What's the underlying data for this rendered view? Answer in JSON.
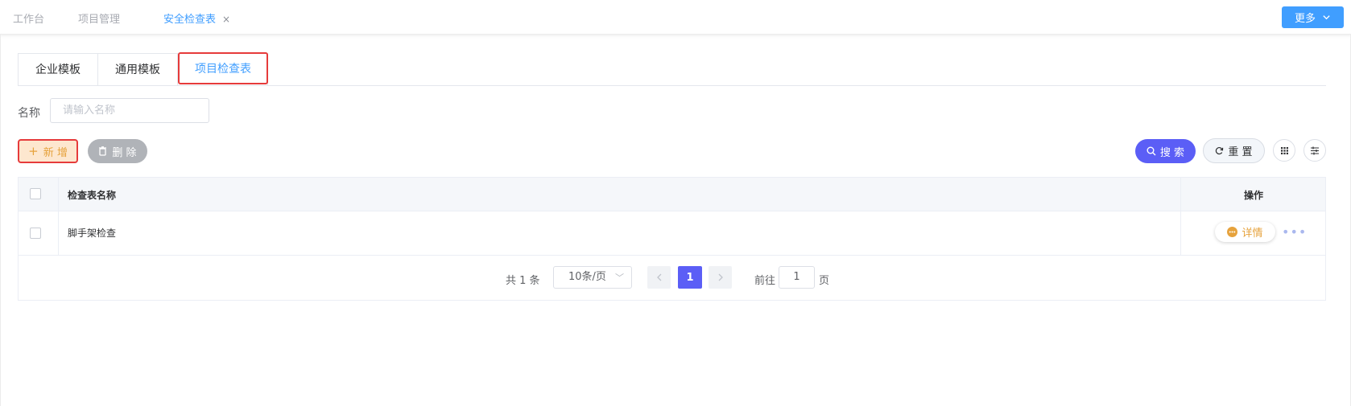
{
  "top_tabs": [
    {
      "label": "工作台"
    },
    {
      "label": "项目管理"
    },
    {
      "label": "安全检查表",
      "close": "×"
    }
  ],
  "more_button": {
    "label": "更多"
  },
  "content_tabs": [
    {
      "label": "企业模板"
    },
    {
      "label": "通用模板"
    },
    {
      "label": "项目检查表"
    }
  ],
  "search": {
    "label": "名称",
    "placeholder": "请输入名称",
    "value": ""
  },
  "toolbar": {
    "add_label": "新 增",
    "delete_label": "删 除",
    "search_label": "搜 索",
    "reset_label": "重 置"
  },
  "table": {
    "columns": [
      "检查表名称",
      "操作"
    ],
    "rows": [
      {
        "name": "脚手架检查",
        "detail_label": "详情",
        "more": "•••"
      }
    ]
  },
  "pagination": {
    "total_text": "共 1 条",
    "page_size": "10条/页",
    "current_page": "1",
    "goto_label": "前往",
    "goto_value": "1",
    "unit_label": "页"
  },
  "colors": {
    "primary": "#409eff",
    "accent": "#5b5ef6",
    "warning": "#e6a23c",
    "highlight_border": "#e63b3b"
  }
}
